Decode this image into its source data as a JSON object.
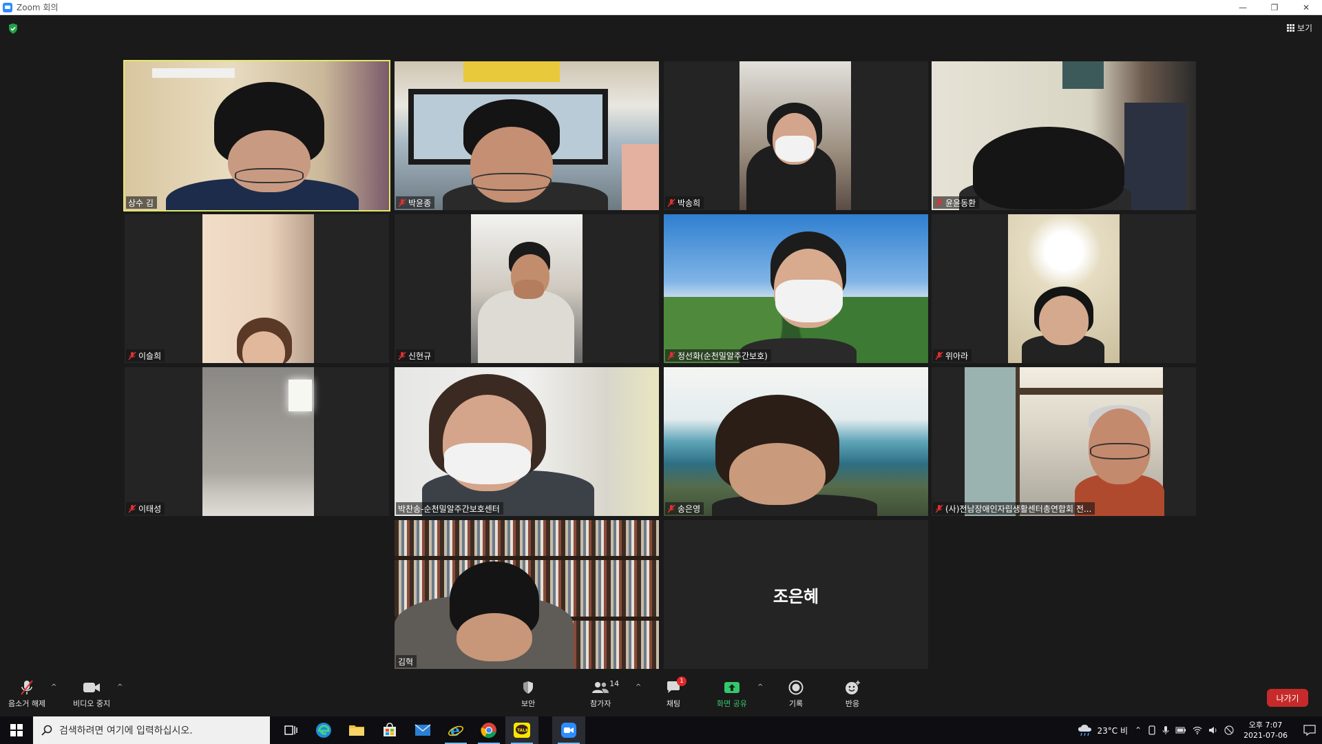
{
  "window": {
    "title": "Zoom 회의"
  },
  "topbar": {
    "view_label": "보기"
  },
  "participants": [
    {
      "name": "상수 김",
      "muted": false,
      "video": true
    },
    {
      "name": "박윤종",
      "muted": true,
      "video": true
    },
    {
      "name": "박송희",
      "muted": true,
      "video": true
    },
    {
      "name": "윤윤동환",
      "muted": true,
      "video": true
    },
    {
      "name": "이슬희",
      "muted": true,
      "video": true
    },
    {
      "name": "신현규",
      "muted": true,
      "video": true
    },
    {
      "name": "정선화(순천밀알주간보호)",
      "muted": true,
      "video": true
    },
    {
      "name": "위아라",
      "muted": true,
      "video": true
    },
    {
      "name": "이태성",
      "muted": true,
      "video": true
    },
    {
      "name": "박찬송-순천밀알주간보호센터",
      "muted": false,
      "video": true
    },
    {
      "name": "송은영",
      "muted": true,
      "video": true
    },
    {
      "name": "(사)전남장애인자립생활센터총연합회 전...",
      "muted": true,
      "video": true
    },
    {
      "name": "김혁",
      "muted": false,
      "video": true
    },
    {
      "name": "조은혜",
      "muted": false,
      "video": false
    }
  ],
  "toolbar": {
    "unmute_label": "음소거 해제",
    "stop_video_label": "비디오 중지",
    "security_label": "보안",
    "participants_label": "참가자",
    "participants_count": "14",
    "chat_label": "채팅",
    "chat_badge": "1",
    "share_label": "화면 공유",
    "record_label": "기록",
    "reactions_label": "반응",
    "leave_label": "나가기"
  },
  "taskbar": {
    "search_placeholder": "검색하려면 여기에 입력하십시오.",
    "weather": "23°C  비",
    "ime": "",
    "time": "오후 7:07",
    "date": "2021-07-06"
  },
  "colors": {
    "active_speaker": "#e2e96a",
    "leave": "#c72a2a",
    "share": "#35c76c",
    "zoom_blue": "#2D8CFF"
  }
}
